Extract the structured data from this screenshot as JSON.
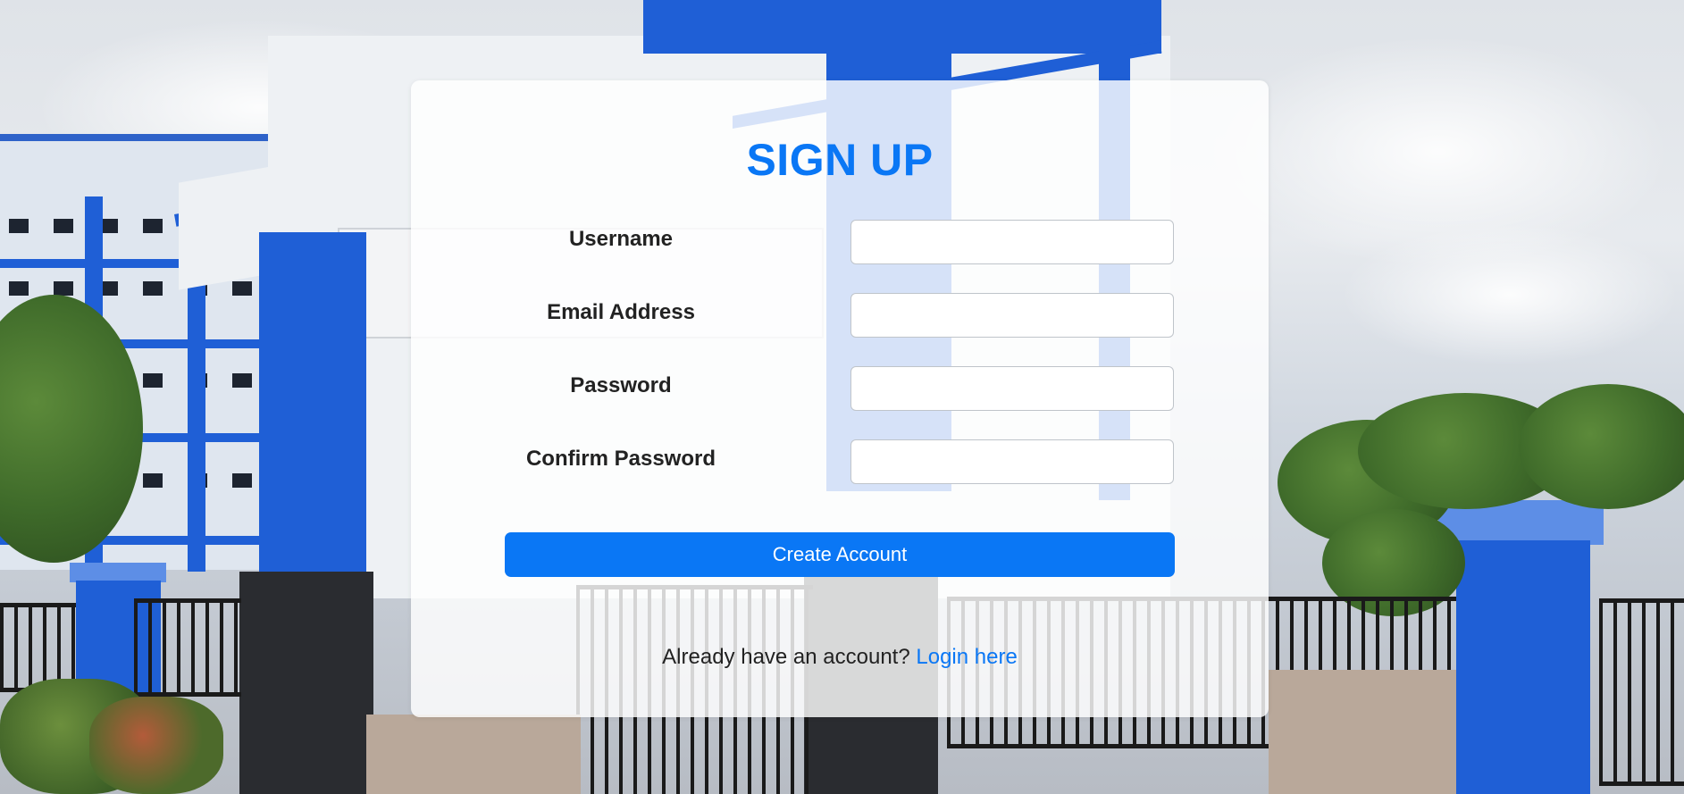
{
  "form": {
    "title": "SIGN UP",
    "fields": [
      {
        "label": "Username",
        "value": "",
        "type": "text"
      },
      {
        "label": "Email Address",
        "value": "",
        "type": "email"
      },
      {
        "label": "Password",
        "value": "",
        "type": "password"
      },
      {
        "label": "Confirm Password",
        "value": "",
        "type": "password"
      }
    ],
    "submit_label": "Create Account",
    "login_prompt": "Already have an account?",
    "login_link": "Login here"
  },
  "colors": {
    "accent": "#0a77f5",
    "card_background": "rgba(255,255,255,0.82)",
    "building_blue": "#1f5fd6"
  }
}
